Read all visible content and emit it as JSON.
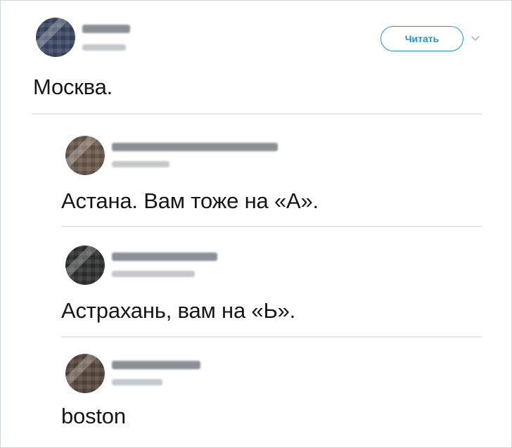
{
  "main_tweet": {
    "follow_label": "Читать",
    "text": "Москва."
  },
  "replies": [
    {
      "text": "Астана. Вам тоже на «А»."
    },
    {
      "text": "Астрахань, вам на «Ь»."
    },
    {
      "text": "boston"
    }
  ],
  "icons": {
    "more": "chevron-down-icon"
  },
  "colors": {
    "accent": "#1b95e0",
    "text": "#14171a",
    "divider": "#e1e8ed"
  }
}
